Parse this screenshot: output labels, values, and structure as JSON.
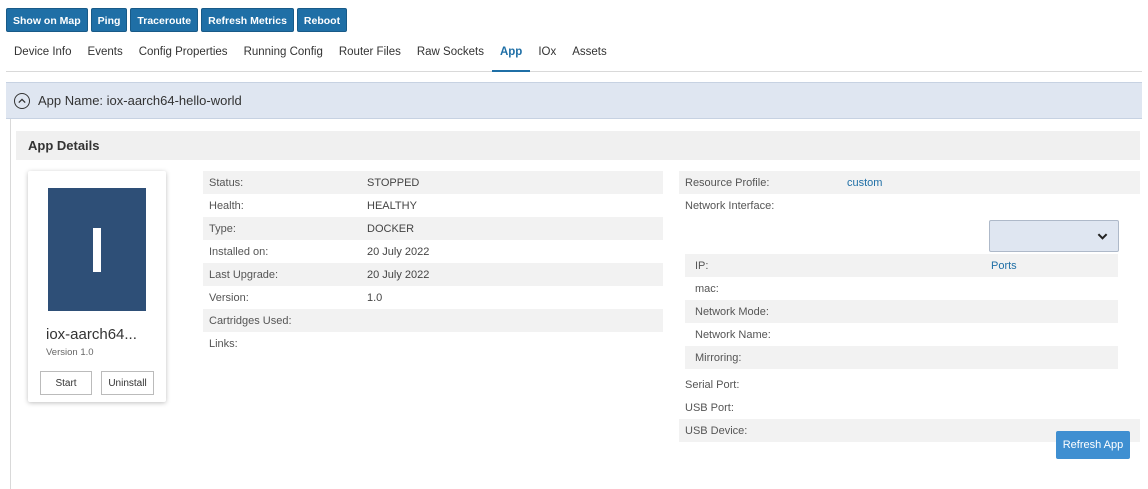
{
  "toolbar": {
    "show_on_map": "Show on Map",
    "ping": "Ping",
    "traceroute": "Traceroute",
    "refresh_metrics": "Refresh Metrics",
    "reboot": "Reboot"
  },
  "tabs": [
    {
      "label": "Device Info"
    },
    {
      "label": "Events"
    },
    {
      "label": "Config Properties"
    },
    {
      "label": "Running Config"
    },
    {
      "label": "Router Files"
    },
    {
      "label": "Raw Sockets"
    },
    {
      "label": "App"
    },
    {
      "label": "IOx"
    },
    {
      "label": "Assets"
    }
  ],
  "active_tab": "App",
  "app": {
    "name_line": "App Name: iox-aarch64-hello-world",
    "collapse_icon": "chevron-up-icon"
  },
  "details": {
    "header": "App Details",
    "card": {
      "tile_letter": "I",
      "title": "iox-aarch64...",
      "version": "Version 1.0",
      "start": "Start",
      "uninstall": "Uninstall",
      "tile_color": "#2e4f77"
    },
    "info": [
      {
        "label": "Status:",
        "value": "STOPPED"
      },
      {
        "label": "Health:",
        "value": "HEALTHY"
      },
      {
        "label": "Type:",
        "value": "DOCKER"
      },
      {
        "label": "Installed on:",
        "value": "20 July 2022"
      },
      {
        "label": "Last Upgrade:",
        "value": "20 July 2022"
      },
      {
        "label": "Version:",
        "value": "1.0"
      },
      {
        "label": "Cartridges Used:",
        "value": ""
      },
      {
        "label": "Links:",
        "value": ""
      }
    ],
    "right": {
      "resource_profile_label": "Resource Profile:",
      "resource_profile_value": "custom",
      "network_interface_label": "Network Interface:",
      "network_interface_value": "",
      "ip_label": "IP:",
      "ports_link": "Ports",
      "mac_label": "mac:",
      "network_mode_label": "Network Mode:",
      "network_name_label": "Network Name:",
      "mirroring_label": "Mirroring:",
      "serial_port_label": "Serial Port:",
      "usb_port_label": "USB Port:",
      "usb_device_label": "USB Device:"
    },
    "refresh_app": "Refresh App"
  },
  "colors": {
    "toolbar_button": "#1f6fa6",
    "active_tab": "#1f6fa6",
    "app_bar": "#dfe6f1",
    "refresh_button": "#3f8fd1",
    "link": "#1f6fa6"
  }
}
